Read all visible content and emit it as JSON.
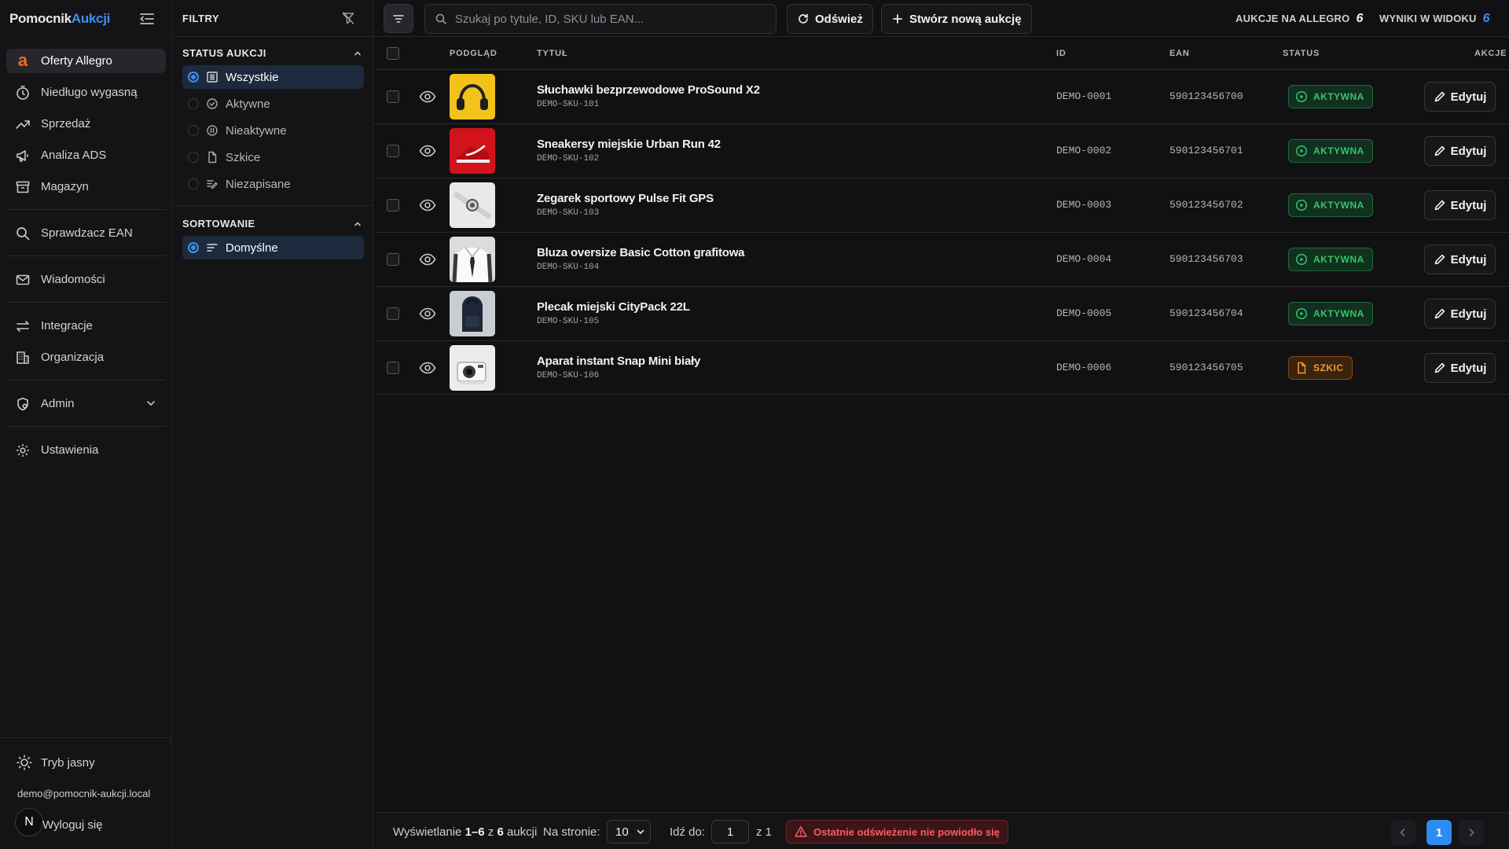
{
  "brand": {
    "part1": "Pomocnik",
    "part2": "Aukcji"
  },
  "sidebar": {
    "items": [
      {
        "label": "Oferty Allegro",
        "icon": "allegro-logo-icon",
        "active": true
      },
      {
        "label": "Niedługo wygasną",
        "icon": "timer-icon"
      },
      {
        "label": "Sprzedaż",
        "icon": "trending-up-icon"
      },
      {
        "label": "Analiza ADS",
        "icon": "megaphone-icon"
      },
      {
        "label": "Magazyn",
        "icon": "archive-box-icon"
      },
      {
        "label": "Sprawdzacz EAN",
        "icon": "search-icon"
      },
      {
        "label": "Wiadomości",
        "icon": "mail-icon"
      },
      {
        "label": "Integracje",
        "icon": "arrows-exchange-icon"
      },
      {
        "label": "Organizacja",
        "icon": "building-icon"
      },
      {
        "label": "Admin",
        "icon": "admin-shield-icon"
      },
      {
        "label": "Ustawienia",
        "icon": "gear-icon"
      }
    ],
    "theme_toggle": "Tryb jasny",
    "email": "demo@pomocnik-aukcji.local",
    "avatar": "N",
    "logout": "Wyloguj się"
  },
  "filters": {
    "title": "FILTRY",
    "status_title": "STATUS AUKCJI",
    "status_options": [
      "Wszystkie",
      "Aktywne",
      "Nieaktywne",
      "Szkice",
      "Niezapisane"
    ],
    "sort_title": "SORTOWANIE",
    "sort_options": [
      "Domyślne"
    ]
  },
  "toolbar": {
    "search_placeholder": "Szukaj po tytule, ID, SKU lub EAN...",
    "refresh": "Odśwież",
    "create": "Stwórz nową aukcję",
    "allegro_count_label": "AUKCJE NA ALLEGRO",
    "allegro_count": "6",
    "view_count_label": "WYNIKI W WIDOKU",
    "view_count": "6"
  },
  "table": {
    "headers": {
      "preview": "PODGLĄD",
      "title": "TYTUŁ",
      "id": "ID",
      "ean": "EAN",
      "status": "STATUS",
      "actions": "AKCJE"
    },
    "rows": [
      {
        "title": "Słuchawki bezprzewodowe ProSound X2",
        "sku": "DEMO-SKU-101",
        "id": "DEMO-0001",
        "ean": "590123456700",
        "status": "AKTYWNA",
        "status_type": "active",
        "edit": "Edytuj",
        "thumb": "headphones"
      },
      {
        "title": "Sneakersy miejskie Urban Run 42",
        "sku": "DEMO-SKU-102",
        "id": "DEMO-0002",
        "ean": "590123456701",
        "status": "AKTYWNA",
        "status_type": "active",
        "edit": "Edytuj",
        "thumb": "sneaker"
      },
      {
        "title": "Zegarek sportowy Pulse Fit GPS",
        "sku": "DEMO-SKU-103",
        "id": "DEMO-0003",
        "ean": "590123456702",
        "status": "AKTYWNA",
        "status_type": "active",
        "edit": "Edytuj",
        "thumb": "watch"
      },
      {
        "title": "Bluza oversize Basic Cotton grafitowa",
        "sku": "DEMO-SKU-104",
        "id": "DEMO-0004",
        "ean": "590123456703",
        "status": "AKTYWNA",
        "status_type": "active",
        "edit": "Edytuj",
        "thumb": "shirt"
      },
      {
        "title": "Plecak miejski CityPack 22L",
        "sku": "DEMO-SKU-105",
        "id": "DEMO-0005",
        "ean": "590123456704",
        "status": "AKTYWNA",
        "status_type": "active",
        "edit": "Edytuj",
        "thumb": "backpack"
      },
      {
        "title": "Aparat instant Snap Mini biały",
        "sku": "DEMO-SKU-106",
        "id": "DEMO-0006",
        "ean": "590123456705",
        "status": "SZKIC",
        "status_type": "draft",
        "edit": "Edytuj",
        "thumb": "camera"
      }
    ]
  },
  "footer": {
    "showing_prefix": "Wyświetlanie",
    "showing_range": "1–6",
    "showing_of": "z",
    "showing_total": "6",
    "showing_suffix": "aukcji",
    "per_page_label": "Na stronie:",
    "per_page_value": "10",
    "goto_label": "Idź do:",
    "goto_value": "1",
    "of_pages": "z 1",
    "error": "Ostatnie odświeżenie nie powiodło się",
    "current_page": "1"
  },
  "colors": {
    "accent": "#2d8cf0",
    "allegro": "#f26b1d",
    "active": "#35c46a",
    "draft": "#f59a2e",
    "error": "#ff5a5f"
  }
}
